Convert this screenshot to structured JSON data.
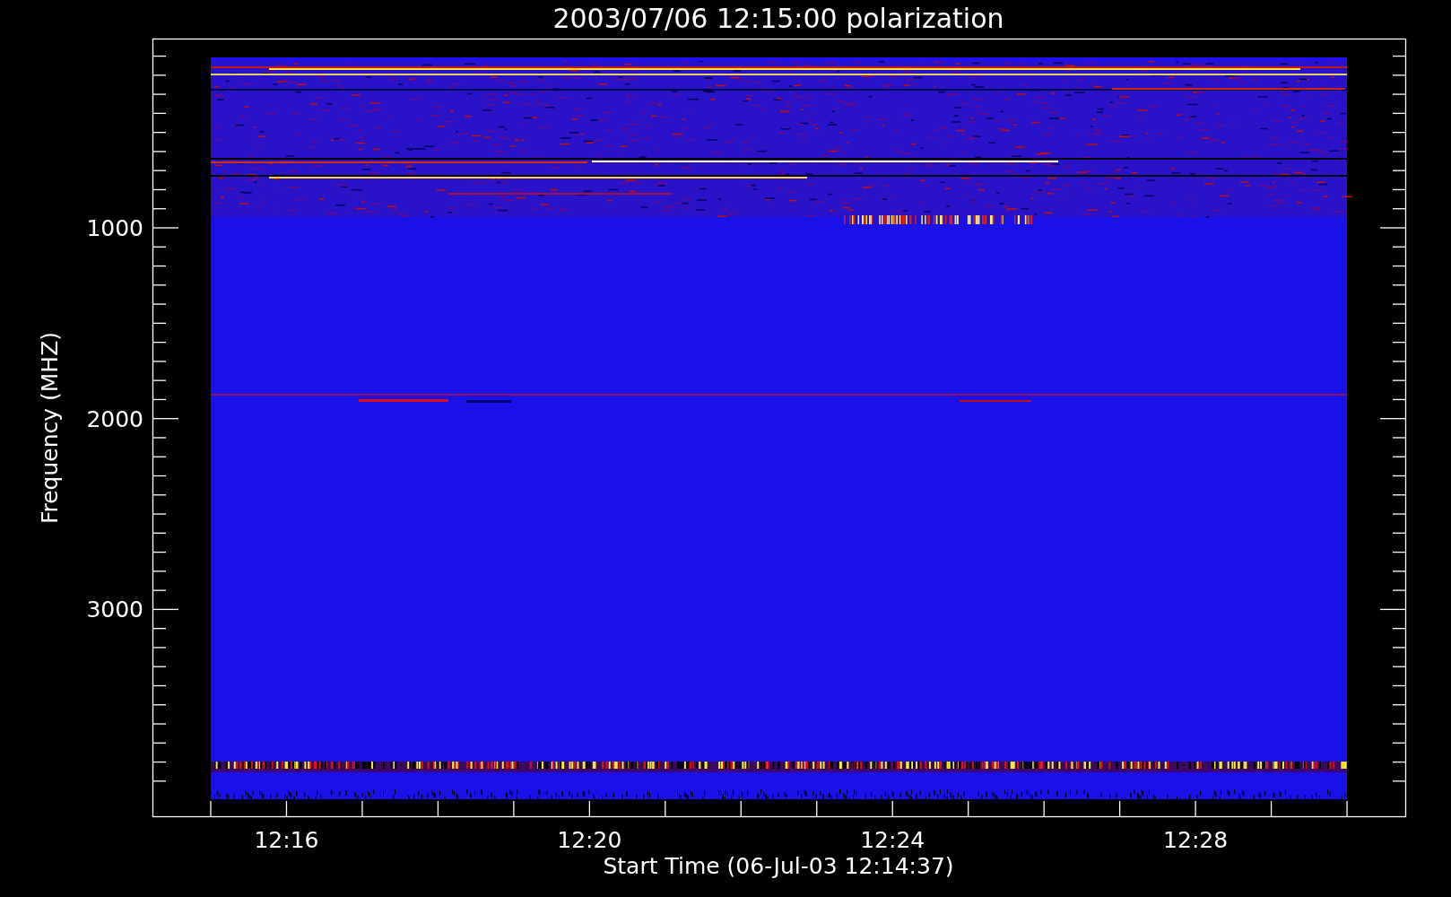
{
  "title": "2003/07/06 12:15:00 polarization",
  "y_axis": {
    "label": "Frequency (MHZ)",
    "tick_labels": [
      "1000",
      "2000",
      "3000"
    ]
  },
  "x_axis": {
    "label": "Start Time (06-Jul-03 12:14:37)",
    "tick_labels": [
      "12:16",
      "12:20",
      "12:24",
      "12:28"
    ]
  }
}
